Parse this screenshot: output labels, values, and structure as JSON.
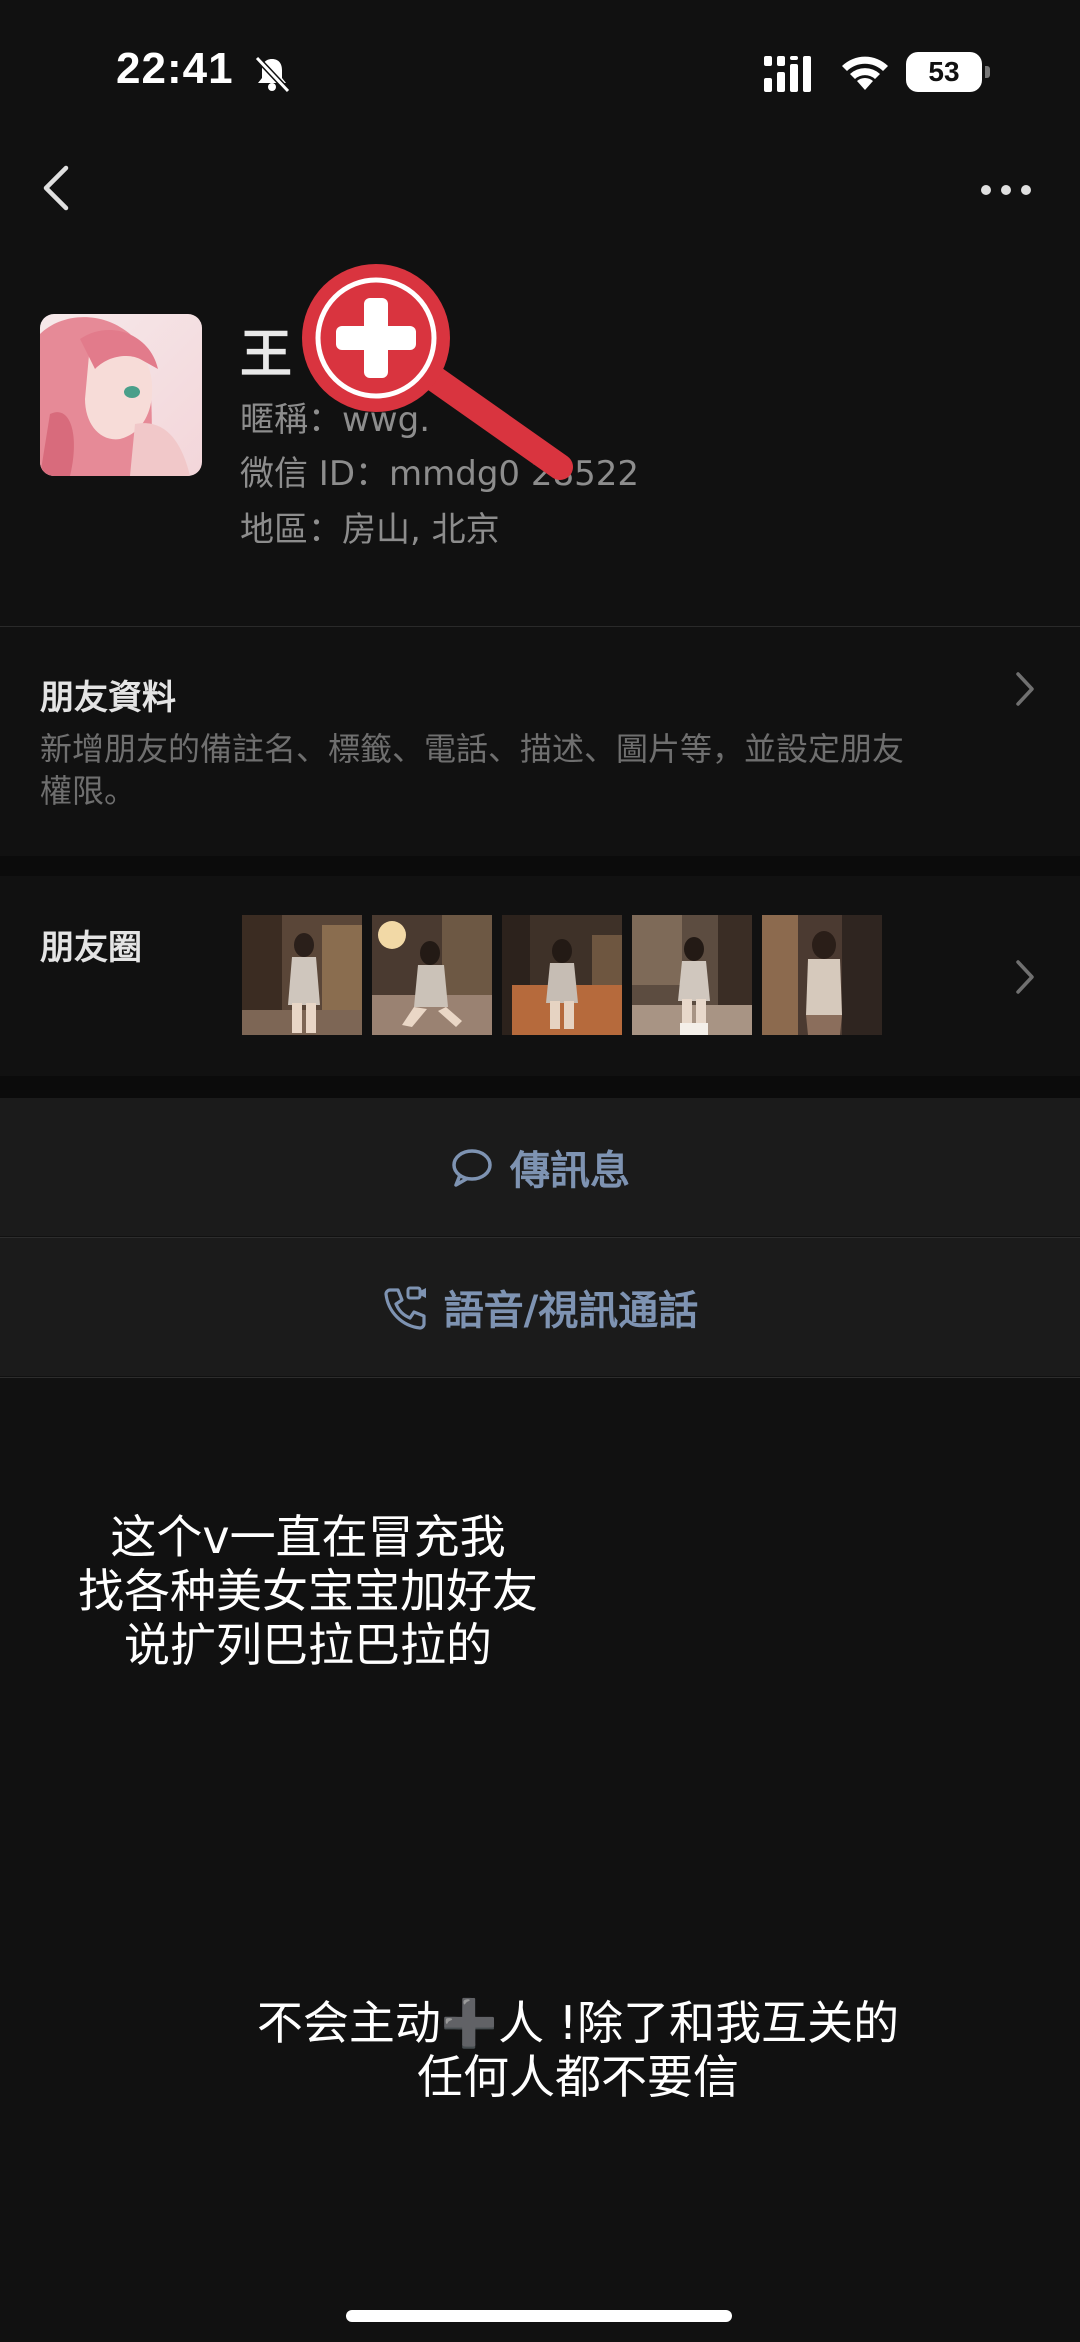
{
  "status_bar": {
    "time": "22:41",
    "battery": "53"
  },
  "profile": {
    "name": "王",
    "nickname_line": "暱稱：wwg.",
    "wechat_id_line": "微信 ID：mmdg0 28522",
    "region_line": "地區：房山, 北京"
  },
  "friend_info": {
    "title": "朋友資料",
    "desc_line1": "新增朋友的備註名、標籤、電話、描述、圖片等，並設定朋友",
    "desc_line2": "權限。"
  },
  "moments": {
    "title": "朋友圈",
    "thumbnails": [
      "photo-1",
      "photo-2",
      "photo-3",
      "photo-4",
      "photo-5"
    ]
  },
  "actions": {
    "message_label": "傳訊息",
    "call_label": "語音/視訊通話"
  },
  "overlay": {
    "caption1_line1": "这个v一直在冒充我",
    "caption1_line2": "找各种美女宝宝加好友",
    "caption1_line3": "说扩列巴拉巴拉的",
    "caption2_line1": "不会主动➕人 !除了和我互关的",
    "caption2_line2": "任何人都不要信"
  },
  "colors": {
    "background": "#111111",
    "action_row": "#1b1b1b",
    "action_text": "#7e93b2",
    "magnifier_red": "#d9343f"
  }
}
